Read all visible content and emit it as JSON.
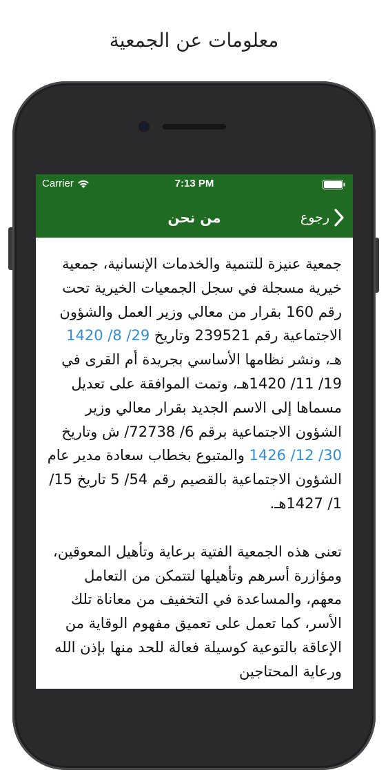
{
  "promo": {
    "title": "معلومات عن الجمعية"
  },
  "status_bar": {
    "carrier": "Carrier",
    "time": "7:13 PM"
  },
  "nav": {
    "title": "من نحن",
    "back_label": "رجوع"
  },
  "content": {
    "p1_a": "جمعية عنيزة للتنمية والخدمات الإنسانية، جمعية خيرية مسجلة في سجل الجمعيات الخيرية تحت رقم 160 بقرار من معالي وزير العمل والشؤون الاجتماعية رقم 239521 وتاريخ ",
    "p1_date1": "29/ 8/ 1420",
    "p1_b": " هـ، ونشر نظامها الأساسي بجريدة أم القرى في 19/ 11/ 1420هـ، وتمت الموافقة على تعديل مسماها إلى الاسم الجديد بقرار معالي وزير الشؤون الاجتماعية برقم 6/ 72738/ ش وتاريخ ",
    "p1_date2": "30/ 12/ 1426",
    "p1_c": " والمتبوع بخطاب سعادة مدير عام الشؤون الاجتماعية بالقصيم رقم 54/ 5 تاريخ 15/ 1/ 1427هـ.",
    "p2": "تعنى هذه الجمعية الفتية برعاية وتأهيل المعوقين، ومؤازرة أسرهم وتأهيلها لتتمكن من التعامل معهم، والمساعدة في التخفيف من معاناة تلك الأسر، كما تعمل على تعميق مفهوم الوقاية من الإعاقة بالتوعية كوسيلة فعالة للحد منها بإذن الله ورعاية المحتاجين"
  },
  "colors": {
    "nav_bg": "#1f6b22",
    "link": "#2f8ed6"
  },
  "icons": {
    "wifi": "wifi-icon",
    "battery": "battery-icon",
    "back": "chevron-right-icon"
  }
}
